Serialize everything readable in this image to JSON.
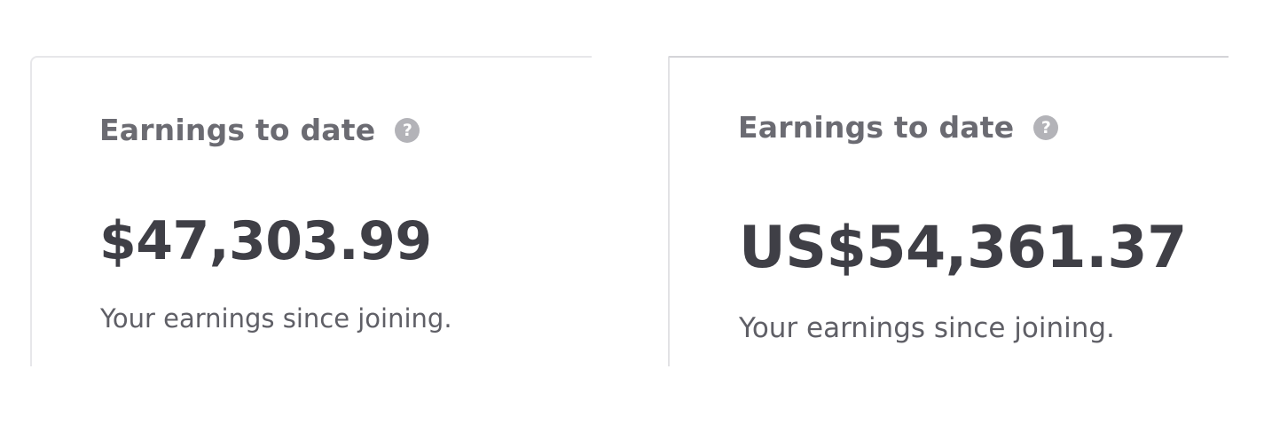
{
  "cards": [
    {
      "title": "Earnings to date",
      "help_icon": "?",
      "amount": "$47,303.99",
      "caption": "Your earnings since joining."
    },
    {
      "title": "Earnings to date",
      "help_icon": "?",
      "amount": "US$54,361.37",
      "caption": "Your earnings since joining."
    }
  ],
  "colors": {
    "title": "#6b6b72",
    "amount": "#3f3f46",
    "caption": "#5f5f66",
    "help_icon_bg": "#b3b3b8",
    "border": "#e7e7ea"
  }
}
